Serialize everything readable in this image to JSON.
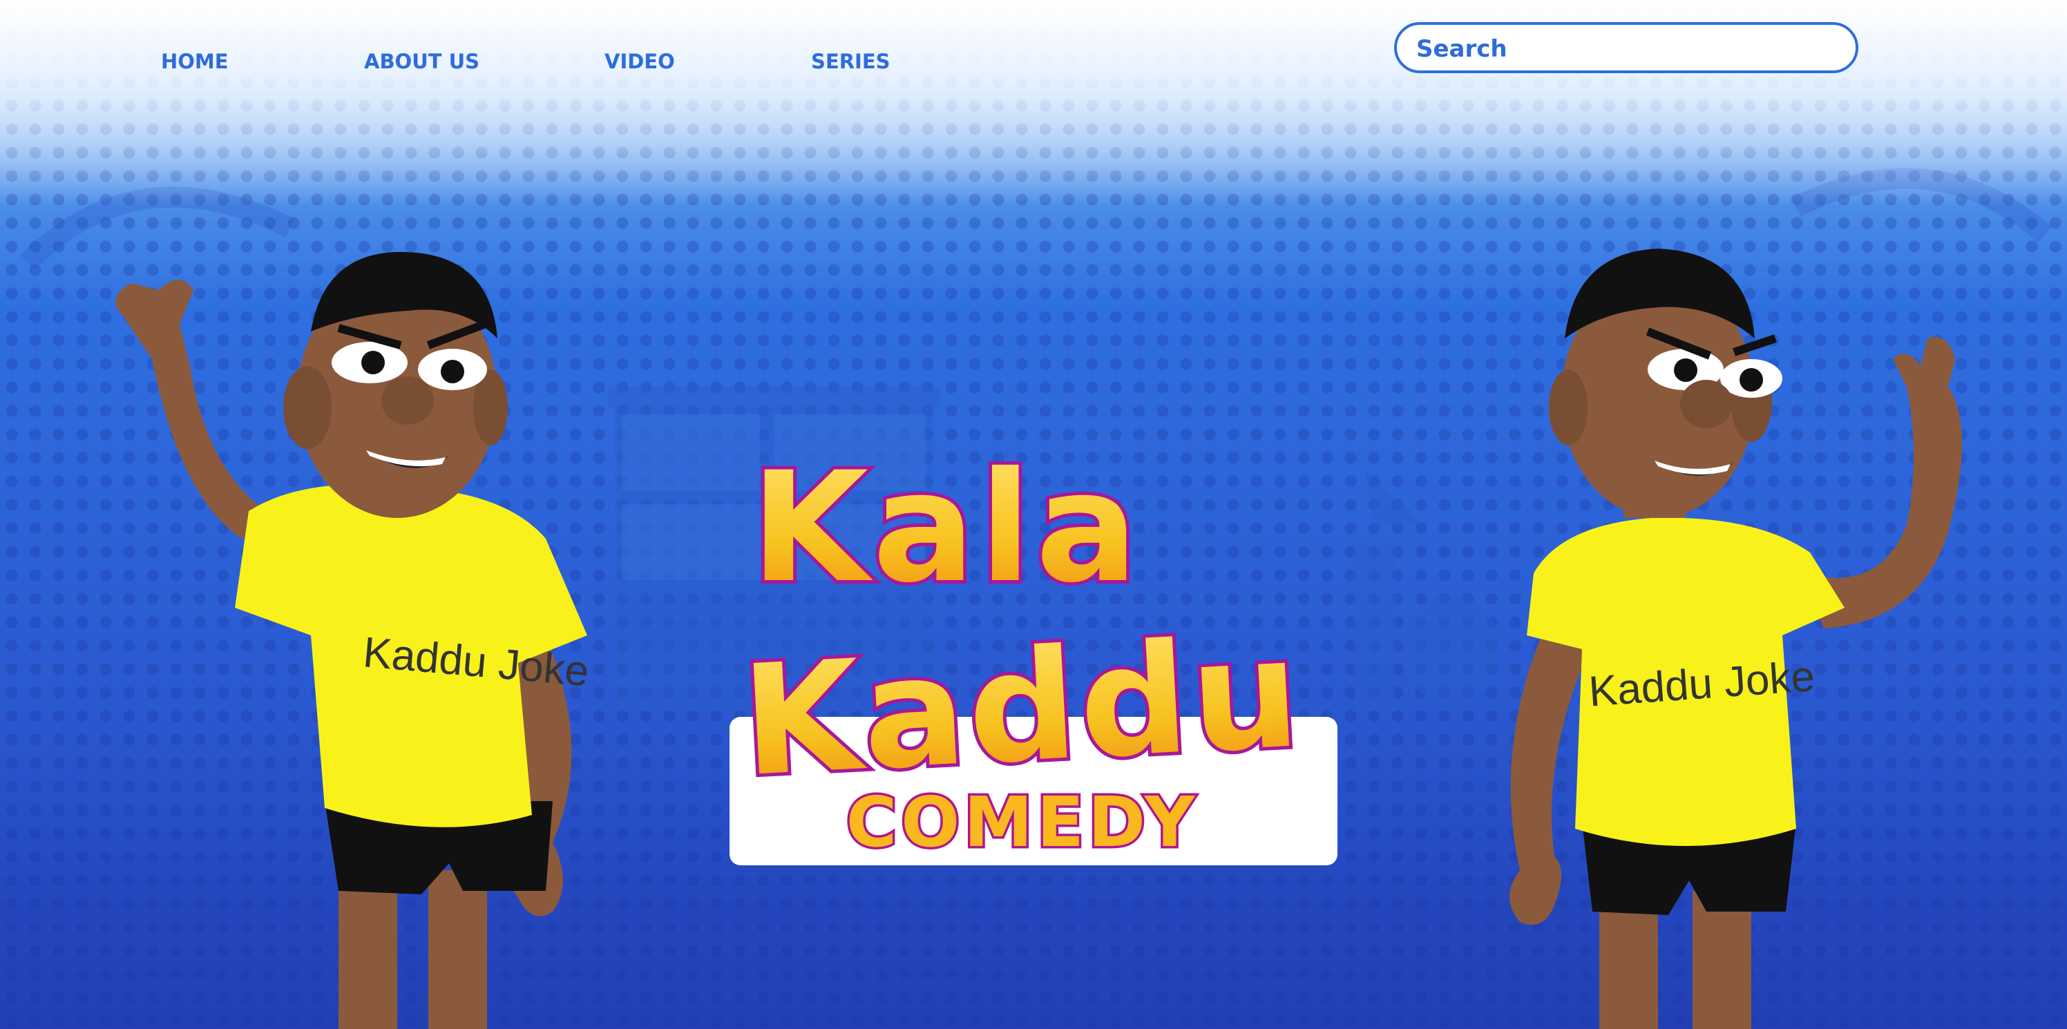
{
  "nav": {
    "items": [
      {
        "label": "HOME"
      },
      {
        "label": "ABOUT US"
      },
      {
        "label": "VIDEO"
      },
      {
        "label": "SERIES"
      }
    ]
  },
  "search": {
    "placeholder": "Search",
    "value": ""
  },
  "logo": {
    "line1": "Kala",
    "line2": "Kaddu",
    "line3": "COMEDY"
  },
  "characters": {
    "left_shirt_text": "Kaddu Joke",
    "right_shirt_text": "Kaddu Joke"
  },
  "colors": {
    "accent": "#2e6cdc",
    "logo_fill": "#f7c21f",
    "logo_outline": "#a8179a",
    "shirt": "#f8f21a"
  }
}
